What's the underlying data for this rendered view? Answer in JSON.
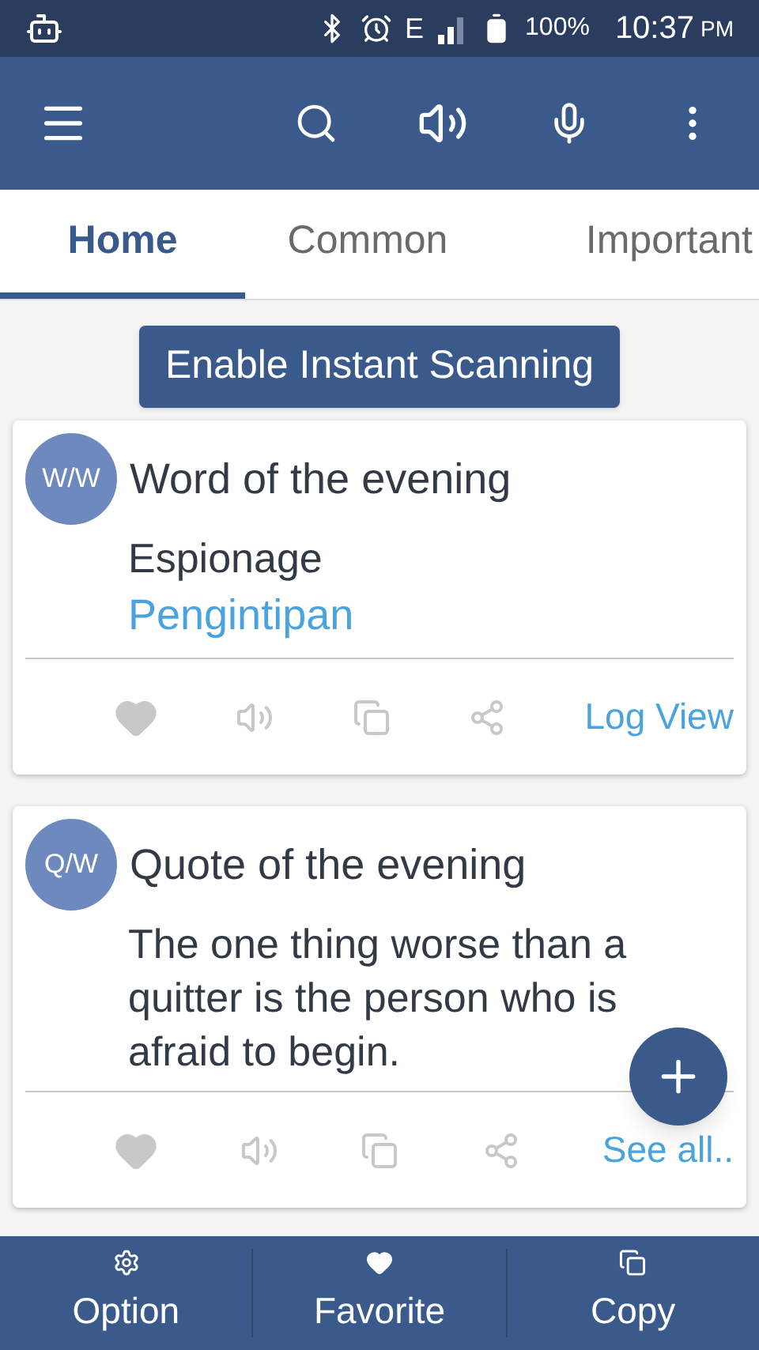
{
  "status_bar": {
    "network": "E",
    "battery": "100%",
    "time": "10:37",
    "ampm": "PM"
  },
  "tabs": [
    {
      "label": "Home",
      "selected": true
    },
    {
      "label": "Common",
      "selected": false
    },
    {
      "label": "Important",
      "selected": false
    }
  ],
  "scan_button": "Enable Instant Scanning",
  "cards": [
    {
      "badge": "W/W",
      "title": "Word of the evening",
      "body": "Espionage",
      "translation": "Pengintipan",
      "link": "Log View"
    },
    {
      "badge": "Q/W",
      "title": "Quote of the evening",
      "body": "The one thing worse than a quitter is the person who is afraid to begin.",
      "link": "See all.."
    }
  ],
  "bottom_nav": [
    {
      "kind": "gear",
      "label": "Option"
    },
    {
      "kind": "heart",
      "label": "Favorite"
    },
    {
      "kind": "copy",
      "label": "Copy"
    }
  ]
}
